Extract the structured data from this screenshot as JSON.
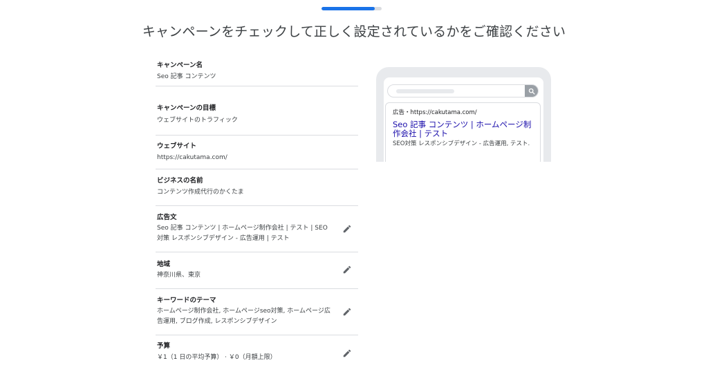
{
  "progress": {
    "percent": 89
  },
  "title": "キャンペーンをチェックして正しく設定されているかをご確認ください",
  "rows": [
    {
      "label": "キャンペーン名",
      "value": "Seo 記事 コンテンツ"
    },
    {
      "label": "キャンペーンの目標",
      "value": "ウェブサイトのトラフィック"
    },
    {
      "label": "ウェブサイト",
      "value": "https://cakutama.com/"
    },
    {
      "label": "ビジネスの名前",
      "value": "コンテンツ作成代行のかくたま"
    },
    {
      "label": "広告文",
      "value": "Seo 記事 コンテンツ | ホームページ制作会社 | テスト | SEO 対策 レスポンシブデザイン - 広告運用 | テスト",
      "edit_icon": "pencil-icon"
    },
    {
      "label": "地域",
      "value": "神奈川県、東京",
      "edit_icon": "pencil-icon"
    },
    {
      "label": "キーワードのテーマ",
      "value": "ホームページ制作会社, ホームページseo対策, ホームページ広告運用, ブログ作成, レスポンシブデザイン",
      "edit_icon": "pencil-icon"
    },
    {
      "label": "予算",
      "value": "￥1（1 日の平均予算） · ￥0（月額上限）",
      "edit_icon": "pencil-icon"
    }
  ],
  "preview": {
    "search_icon": "search-icon",
    "ad_url": "広告・https://cakutama.com/",
    "headline": "Seo 記事 コンテンツ | ホームページ制作会社 | テスト",
    "description": "SEO対策 レスポンシブデザイン - 広告運用, テスト."
  },
  "colors": {
    "accent": "#1a73e8",
    "link": "#1a0dab",
    "icon": "#5f6368"
  }
}
